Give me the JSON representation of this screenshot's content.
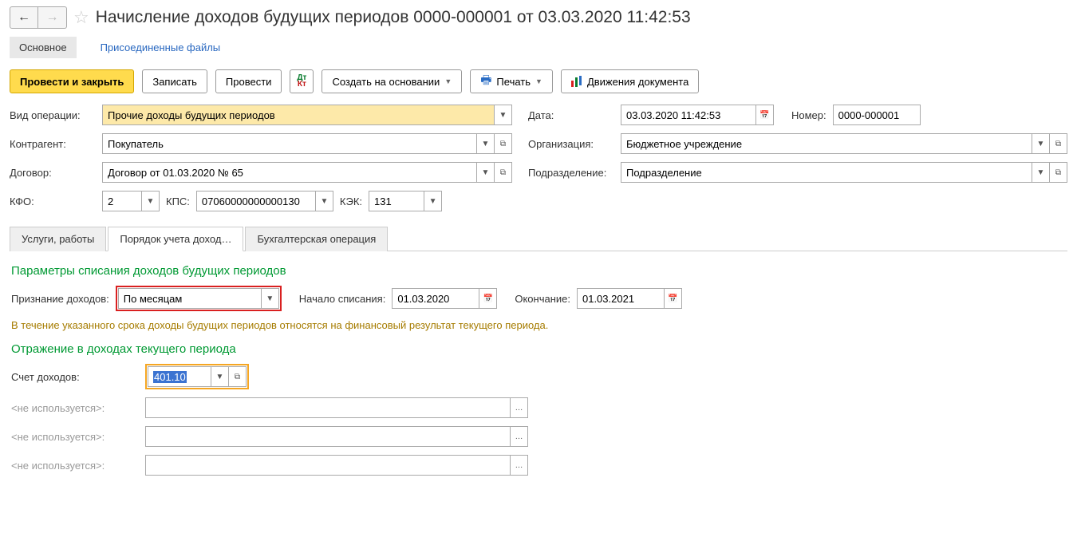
{
  "title": "Начисление доходов будущих периодов 0000-000001 от 03.03.2020 11:42:53",
  "navTabs": {
    "main": "Основное",
    "files": "Присоединенные файлы"
  },
  "toolbar": {
    "post_close": "Провести и закрыть",
    "save": "Записать",
    "post": "Провести",
    "create_base": "Создать на основании",
    "print": "Печать",
    "movements": "Движения документа"
  },
  "labels": {
    "op_type": "Вид операции:",
    "date": "Дата:",
    "number": "Номер:",
    "contragent": "Контрагент:",
    "org": "Организация:",
    "contract": "Договор:",
    "dept": "Подразделение:",
    "kfo": "КФО:",
    "kps": "КПС:",
    "kek": "КЭК:"
  },
  "values": {
    "op_type": "Прочие доходы будущих периодов",
    "date": "03.03.2020 11:42:53",
    "number": "0000-000001",
    "contragent": "Покупатель",
    "org": "Бюджетное учреждение",
    "contract": "Договор от 01.03.2020 № 65",
    "dept": "Подразделение",
    "kfo": "2",
    "kps": "07060000000000130",
    "kek": "131"
  },
  "tabs": {
    "t1": "Услуги, работы",
    "t2": "Порядок учета доход…",
    "t3": "Бухгалтерская операция"
  },
  "section1": {
    "header": "Параметры списания доходов будущих периодов",
    "recog_lbl": "Признание доходов:",
    "recog_val": "По месяцам",
    "start_lbl": "Начало списания:",
    "start_val": "01.03.2020",
    "end_lbl": "Окончание:",
    "end_val": "01.03.2021",
    "note": "В течение указанного срока доходы будущих периодов относятся на финансовый результат текущего периода."
  },
  "section2": {
    "header": "Отражение в доходах текущего периода",
    "acc_lbl": "Счет доходов:",
    "acc_val": "401.10",
    "unused": "<не используется>:"
  }
}
